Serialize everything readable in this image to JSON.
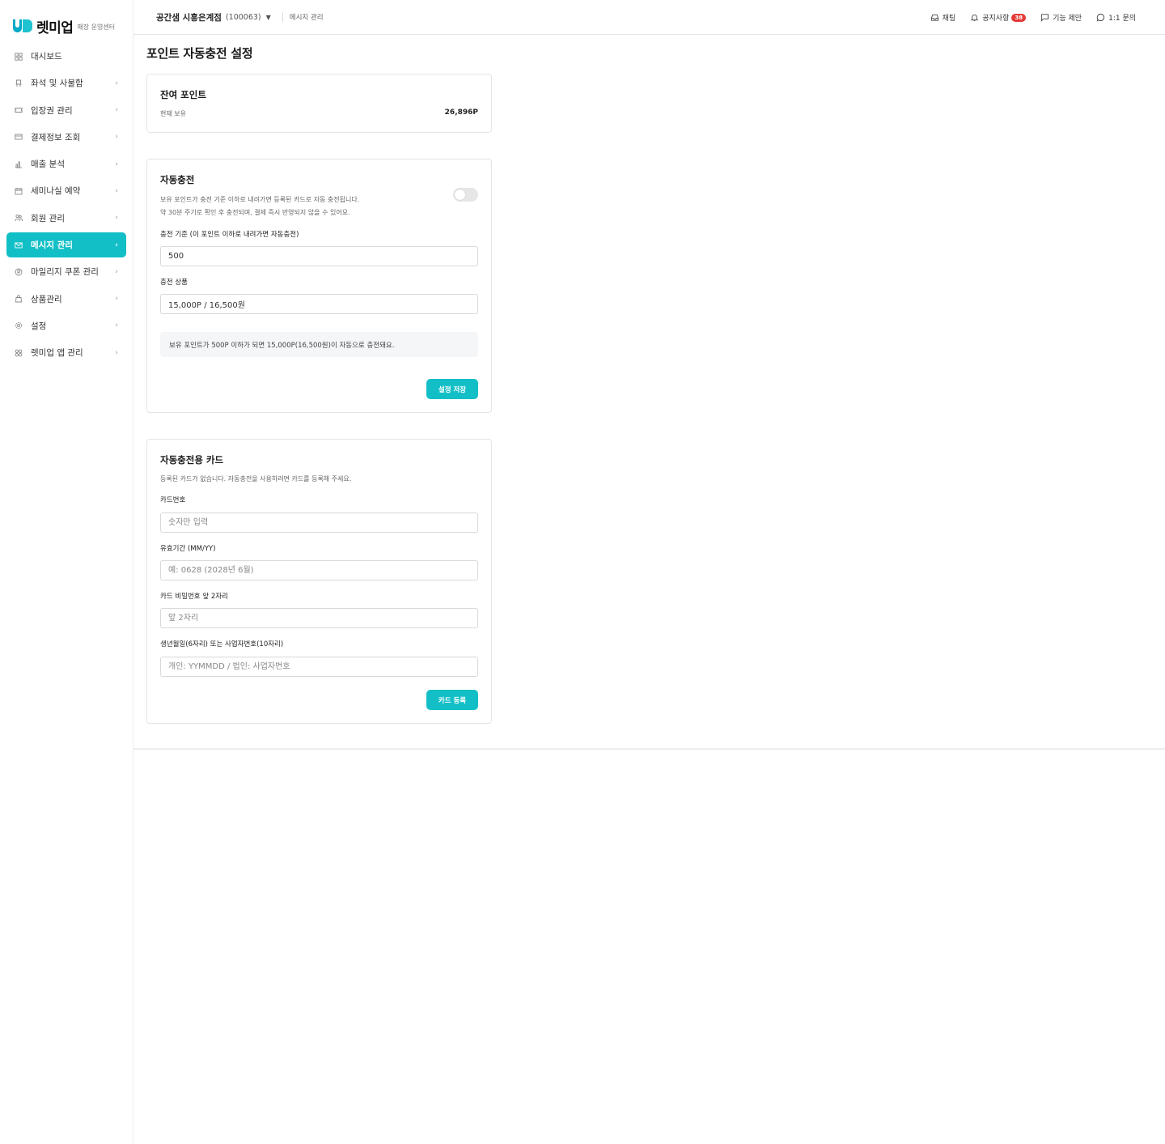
{
  "brand": {
    "name": "렛미업",
    "sub": "매장 운영센터"
  },
  "sidebar": {
    "items": [
      {
        "label": "대시보드",
        "icon": "dashboard-icon",
        "chevron": false,
        "active": false
      },
      {
        "label": "좌석 및 사물함",
        "icon": "seat-icon",
        "chevron": true,
        "active": false
      },
      {
        "label": "입장권 관리",
        "icon": "ticket-icon",
        "chevron": true,
        "active": false
      },
      {
        "label": "결제정보 조회",
        "icon": "card-icon",
        "chevron": true,
        "active": false
      },
      {
        "label": "매출 분석",
        "icon": "chart-icon",
        "chevron": true,
        "active": false
      },
      {
        "label": "세미나실 예약",
        "icon": "calendar-icon",
        "chevron": true,
        "active": false
      },
      {
        "label": "회원 관리",
        "icon": "users-icon",
        "chevron": true,
        "active": false
      },
      {
        "label": "메시지 관리",
        "icon": "mail-icon",
        "chevron": true,
        "active": true
      },
      {
        "label": "마일리지 쿠폰 관리",
        "icon": "coin-icon",
        "chevron": true,
        "active": false
      },
      {
        "label": "상품관리",
        "icon": "bag-icon",
        "chevron": true,
        "active": false
      },
      {
        "label": "설정",
        "icon": "gear-icon",
        "chevron": true,
        "active": false
      },
      {
        "label": "렛미업 앱 관리",
        "icon": "apps-icon",
        "chevron": true,
        "active": false
      }
    ],
    "chevron_glyph": "›"
  },
  "topbar": {
    "store_name": "공간샘 시흥은계점",
    "store_id": "(100063)",
    "caret": "▼",
    "breadcrumb": "메시지 관리",
    "links": {
      "chat": "채팅",
      "notice": "공지사항",
      "notice_badge": "38",
      "suggest": "기능 제안",
      "inquiry": "1:1 문의"
    }
  },
  "page": {
    "title": "포인트 자동충전 설정",
    "balance": {
      "title": "잔여 포인트",
      "label": "현재 보유",
      "value": "26,896P"
    },
    "autocharge": {
      "title": "자동충전",
      "enabled": false,
      "desc1": "보유 포인트가 충전 기준 이하로 내려가면 등록된 카드로 자동 충전됩니다.",
      "desc2": "약 30분 주기로 확인 후 충전되며, 결제 즉시 반영되지 않을 수 있어요.",
      "threshold_label": "충전 기준 (이 포인트 이하로 내려가면 자동충전)",
      "threshold_value": "500",
      "product_label": "충전 상품",
      "product_value": "15,000P / 16,500원",
      "info": "보유 포인트가 500P 이하가 되면 15,000P(16,500원)이 자동으로 충전돼요.",
      "save_label": "설정 저장"
    },
    "card": {
      "title": "자동충전용 카드",
      "desc": "등록된 카드가 없습니다. 자동충전을 사용하려면 카드를 등록해 주세요.",
      "number_label": "카드번호",
      "number_placeholder": "숫자만 입력",
      "expiry_label": "유효기간 (MM/YY)",
      "expiry_placeholder": "예: 0628 (2028년 6월)",
      "pw_label": "카드 비밀번호 앞 2자리",
      "pw_placeholder": "앞 2자리",
      "birth_label": "생년월일(6자리) 또는 사업자번호(10자리)",
      "birth_placeholder": "개인: YYMMDD / 법인: 사업자번호",
      "register_label": "카드 등록"
    }
  },
  "colors": {
    "accent": "#13bfc6",
    "badge": "#e53935"
  }
}
